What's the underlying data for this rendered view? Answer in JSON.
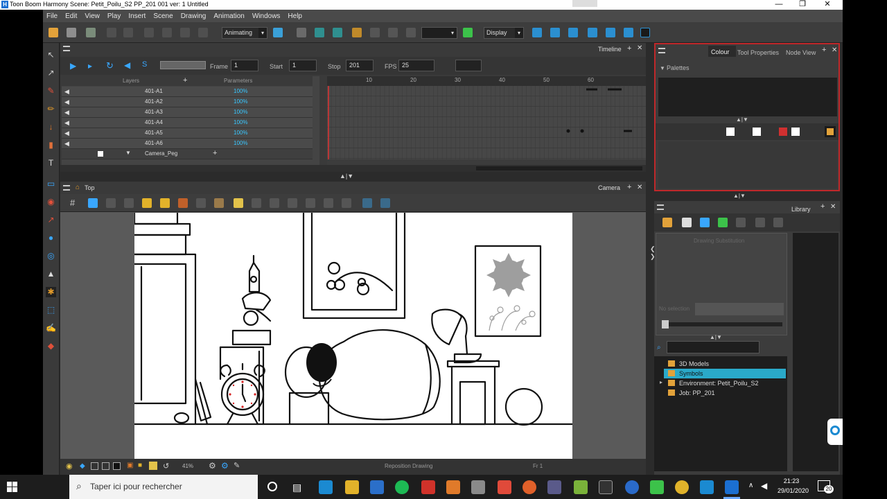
{
  "window": {
    "logo": "H",
    "title": "Toon Boom Harmony Scene: Petit_Poilu_S2 PP_201 001 ver: 1 Untitled",
    "minimize": "—",
    "restore": "❐",
    "close": "✕"
  },
  "menu": [
    "File",
    "Edit",
    "View",
    "Play",
    "Insert",
    "Scene",
    "Drawing",
    "Animation",
    "Windows",
    "Help"
  ],
  "toolbar": {
    "workspace_mode": "Animating",
    "display_label": "Display",
    "dropdown_arrow": "▾"
  },
  "timeline": {
    "tab": "Timeline",
    "frame_label": "Frame",
    "frame_value": "1",
    "start_label": "Start",
    "start_value": "1",
    "stop_label": "Stop",
    "stop_value": "201",
    "fps_label": "FPS",
    "fps_value": "25",
    "layers_header": "Layers",
    "parameters_header": "Parameters",
    "layers": [
      {
        "name": "401-A1",
        "param": "100%"
      },
      {
        "name": "401-A2",
        "param": "100%"
      },
      {
        "name": "401-A3",
        "param": "100%"
      },
      {
        "name": "401-A4",
        "param": "100%"
      },
      {
        "name": "401-A5",
        "param": "100%"
      },
      {
        "name": "401-A6",
        "param": "100%"
      },
      {
        "name": "Camera_Peg",
        "param": ""
      }
    ],
    "ruler_marks": [
      "10",
      "20",
      "30",
      "40",
      "50",
      "60"
    ]
  },
  "camera": {
    "breadcrumb": "Top",
    "tab": "Camera",
    "zoom": "41%",
    "status_center": "Reposition Drawing",
    "status_frame": "Fr 1"
  },
  "colour_panel": {
    "tabs": [
      "Colour",
      "Tool Properties",
      "Node View"
    ],
    "palettes_label": "Palettes"
  },
  "library_panel": {
    "tab": "Library",
    "drawing_substitution": "Drawing Substitution",
    "no_selection": "No selection",
    "tree": [
      {
        "label": "3D Models",
        "selected": false
      },
      {
        "label": "Symbols",
        "selected": true
      },
      {
        "label": "Environment: Petit_Poilu_S2",
        "selected": false
      },
      {
        "label": "Job: PP_201",
        "selected": false
      }
    ]
  },
  "taskbar": {
    "search_placeholder": "Taper ici pour rechercher",
    "time": "21:23",
    "date": "29/01/2020",
    "notification_count": "20"
  },
  "colors": {
    "accent_blue": "#39c7ff",
    "selected_row": "#2aa9c9",
    "active_border": "#c0282a"
  }
}
